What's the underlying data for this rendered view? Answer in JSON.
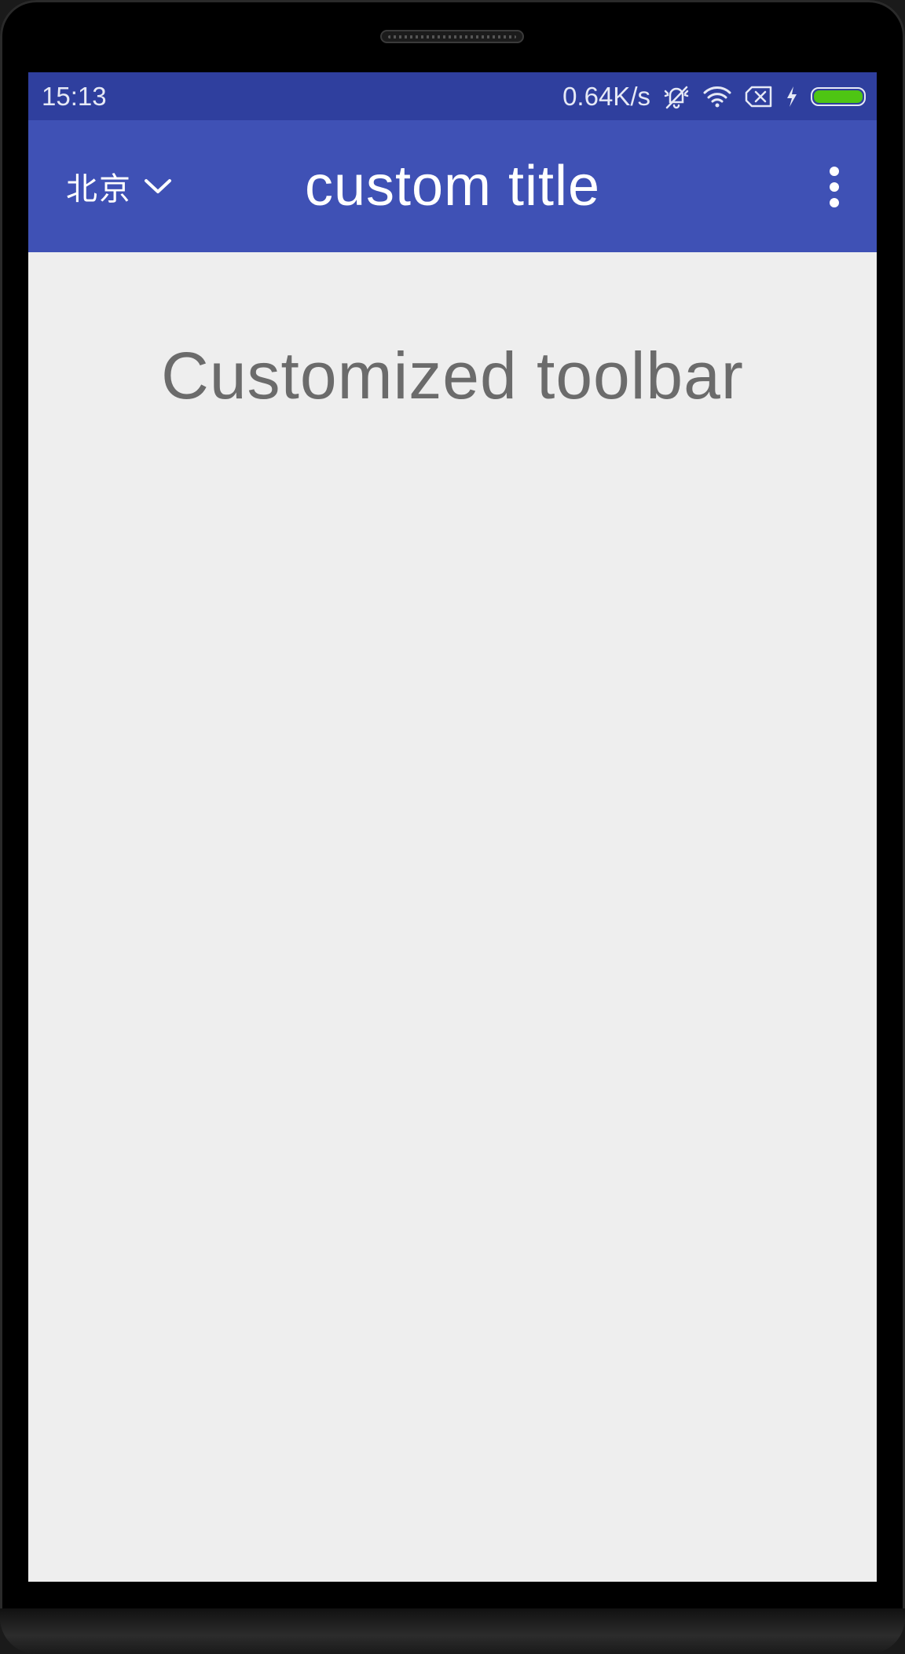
{
  "status_bar": {
    "time": "15:13",
    "network_speed": "0.64K/s",
    "icons": [
      "silent-icon",
      "wifi-icon",
      "no-sim-icon",
      "charging-icon",
      "battery-icon"
    ],
    "battery_color": "#4ec513"
  },
  "toolbar": {
    "city_label": "北京",
    "city_dropdown_icon": "chevron-down-icon",
    "title": "custom title",
    "menu_icon": "more-vert-icon",
    "color": "#3f51b5"
  },
  "content": {
    "text": "Customized toolbar"
  },
  "colors": {
    "status_bar": "#2f3f9e",
    "background": "#eeeeee",
    "content_text": "#6b6b6b"
  }
}
